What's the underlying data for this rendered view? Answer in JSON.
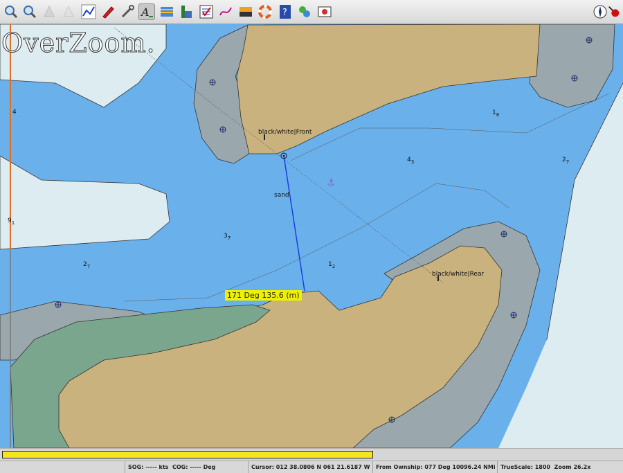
{
  "toolbar": {
    "tools": [
      {
        "name": "zoom-in",
        "icon": "magnifier-plus-icon"
      },
      {
        "name": "zoom-out",
        "icon": "magnifier-minus-icon"
      },
      {
        "name": "scale-in",
        "icon": "scale-in-icon"
      },
      {
        "name": "scale-out",
        "icon": "scale-out-icon"
      },
      {
        "name": "route",
        "icon": "route-icon"
      },
      {
        "name": "follow",
        "icon": "ship-icon"
      },
      {
        "name": "settings",
        "icon": "wrench-icon"
      },
      {
        "name": "text",
        "icon": "text-icon"
      },
      {
        "name": "current",
        "icon": "current-icon"
      },
      {
        "name": "tide",
        "icon": "tide-icon"
      },
      {
        "name": "route-manager",
        "icon": "route-manager-icon"
      },
      {
        "name": "track",
        "icon": "track-icon"
      },
      {
        "name": "color-scheme",
        "icon": "color-scheme-icon"
      },
      {
        "name": "mob",
        "icon": "lifebuoy-icon"
      },
      {
        "name": "help",
        "icon": "help-icon"
      },
      {
        "name": "aton",
        "icon": "aton-icon"
      },
      {
        "name": "screenshot",
        "icon": "screenshot-icon"
      }
    ],
    "right": {
      "name": "north-up",
      "icon": "compass-icon"
    }
  },
  "chart": {
    "overlay_text": "OverZoom.",
    "measure_label": "171 Deg 135.6 (m)",
    "labels": {
      "front": "black/white|Front",
      "rear": "black/white|Rear",
      "sand": "sand"
    },
    "soundings": [
      {
        "v": "4",
        "sub": ""
      },
      {
        "v": "1",
        "sub": "8"
      },
      {
        "v": "4",
        "sub": "3"
      },
      {
        "v": "2",
        "sub": "7"
      },
      {
        "v": "3",
        "sub": "7"
      },
      {
        "v": "1",
        "sub": "2"
      },
      {
        "v": "2",
        "sub": "7"
      },
      {
        "v": "9",
        "sub": "1"
      }
    ],
    "colors": {
      "water": "#6ab1ec",
      "land": "#c9b27e",
      "shallow": "#dcecf1",
      "intertidal": "#9aa8ae",
      "marsh": "#7ba68e",
      "measure_bg": "#f0f000"
    }
  },
  "progress": {
    "fill_fraction": 0.6,
    "color": "#f4e61a"
  },
  "status": {
    "sog": "SOG: ----- kts",
    "cog": "COG: ----- Deg",
    "cursor": "Cursor: 012 38.0806 N 061 21.6187 W",
    "ownship": "From Ownship: 077 Deg  10096.24 NMi",
    "truescale": "TrueScale:     1800",
    "zoom": "Zoom 26.2x"
  }
}
